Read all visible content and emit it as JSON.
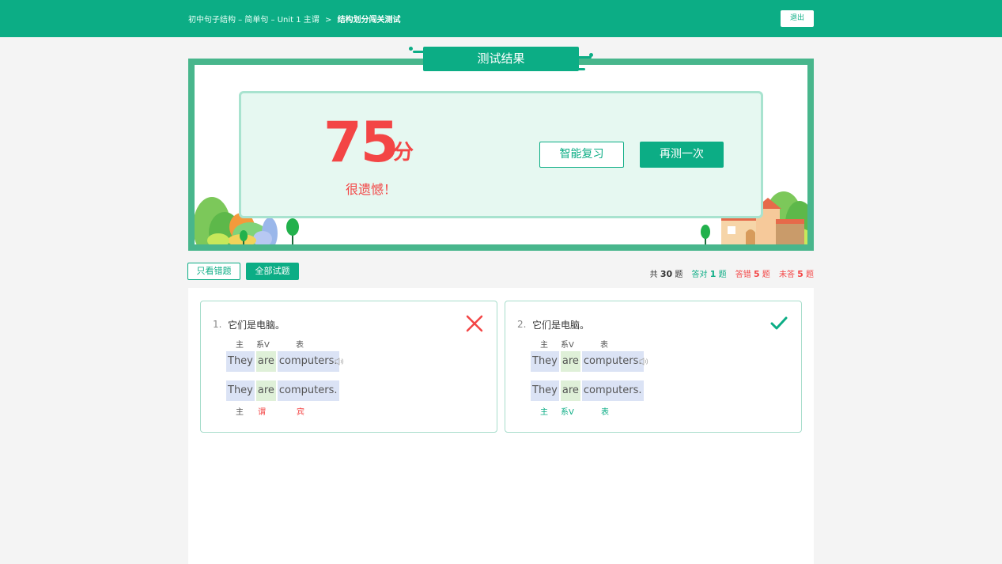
{
  "header": {
    "crumb_1": "初中句子结构 – 简单句 – Unit 1 主谓",
    "separator": ">",
    "current": "结构划分闯关测试",
    "exit_label": "退出"
  },
  "result": {
    "title": "测试结果",
    "score": "75",
    "unit": "分",
    "message": "很遗憾！",
    "review_label": "智能复习",
    "retry_label": "再测一次"
  },
  "filters": {
    "wrong_only": "只看错题",
    "all": "全部试题"
  },
  "stats": {
    "total_prefix": "共",
    "total": "30",
    "total_suffix": "题",
    "correct_prefix": "答对",
    "correct": "1",
    "correct_suffix": "题",
    "wrong_prefix": "答错",
    "wrong": "5",
    "wrong_suffix": "题",
    "unanswered_prefix": "未答",
    "unanswered": "5",
    "unanswered_suffix": "题"
  },
  "questions": [
    {
      "number": "1.",
      "text": "它们是电脑。",
      "result": "wrong",
      "answer_roles": [
        "主",
        "系V",
        "表"
      ],
      "segments": [
        "They",
        "are",
        "computers."
      ],
      "user_segments": [
        "They",
        "are",
        "computers."
      ],
      "user_roles": [
        "主",
        "谓",
        "宾"
      ]
    },
    {
      "number": "2.",
      "text": "它们是电脑。",
      "result": "correct",
      "answer_roles": [
        "主",
        "系V",
        "表"
      ],
      "segments": [
        "They",
        "are",
        "computers."
      ],
      "user_segments": [
        "They",
        "are",
        "computers."
      ],
      "user_roles": [
        "主",
        "系V",
        "表"
      ]
    }
  ],
  "colors": {
    "brand": "#0cad85",
    "error": "#f34545"
  }
}
